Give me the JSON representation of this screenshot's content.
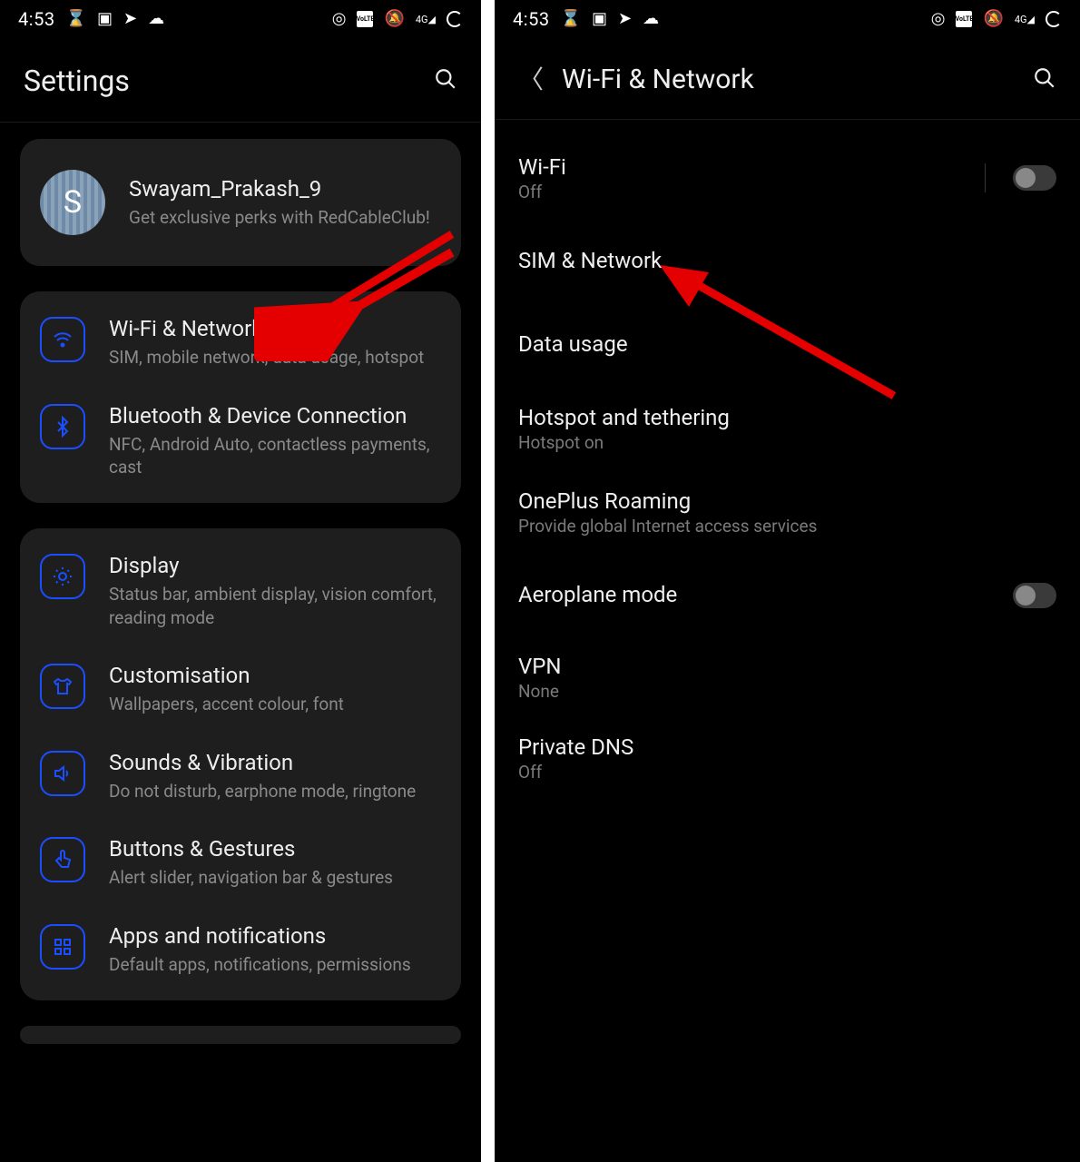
{
  "statusbar": {
    "time": "4:53",
    "volte": "VoLTE",
    "signal": "4G"
  },
  "left": {
    "header": {
      "title": "Settings"
    },
    "account": {
      "initial": "S",
      "name": "Swayam_Prakash_9",
      "sub": "Get exclusive perks with RedCableClub!"
    },
    "groups": [
      {
        "items": [
          {
            "icon": "wifi",
            "title": "Wi-Fi & Network",
            "sub": "SIM, mobile network, data usage, hotspot"
          },
          {
            "icon": "bluetooth",
            "title": "Bluetooth & Device Connection",
            "sub": "NFC, Android Auto, contactless payments, cast"
          }
        ]
      },
      {
        "items": [
          {
            "icon": "display",
            "title": "Display",
            "sub": "Status bar, ambient display, vision comfort, reading mode"
          },
          {
            "icon": "shirt",
            "title": "Customisation",
            "sub": "Wallpapers, accent colour, font"
          },
          {
            "icon": "sound",
            "title": "Sounds & Vibration",
            "sub": "Do not disturb, earphone mode, ringtone"
          },
          {
            "icon": "gesture",
            "title": "Buttons & Gestures",
            "sub": "Alert slider, navigation bar & gestures"
          },
          {
            "icon": "apps",
            "title": "Apps and notifications",
            "sub": "Default apps, notifications, permissions"
          }
        ]
      }
    ]
  },
  "right": {
    "header": {
      "title": "Wi-Fi & Network"
    },
    "items": [
      {
        "title": "Wi-Fi",
        "sub": "Off",
        "toggle": false
      },
      {
        "title": "SIM & Network"
      },
      {
        "title": "Data usage"
      },
      {
        "title": "Hotspot and tethering",
        "sub": "Hotspot on"
      },
      {
        "title": "OnePlus Roaming",
        "sub": "Provide global Internet access services"
      },
      {
        "title": "Aeroplane mode",
        "toggle": false
      },
      {
        "title": "VPN",
        "sub": "None"
      },
      {
        "title": "Private DNS",
        "sub": "Off"
      }
    ]
  }
}
